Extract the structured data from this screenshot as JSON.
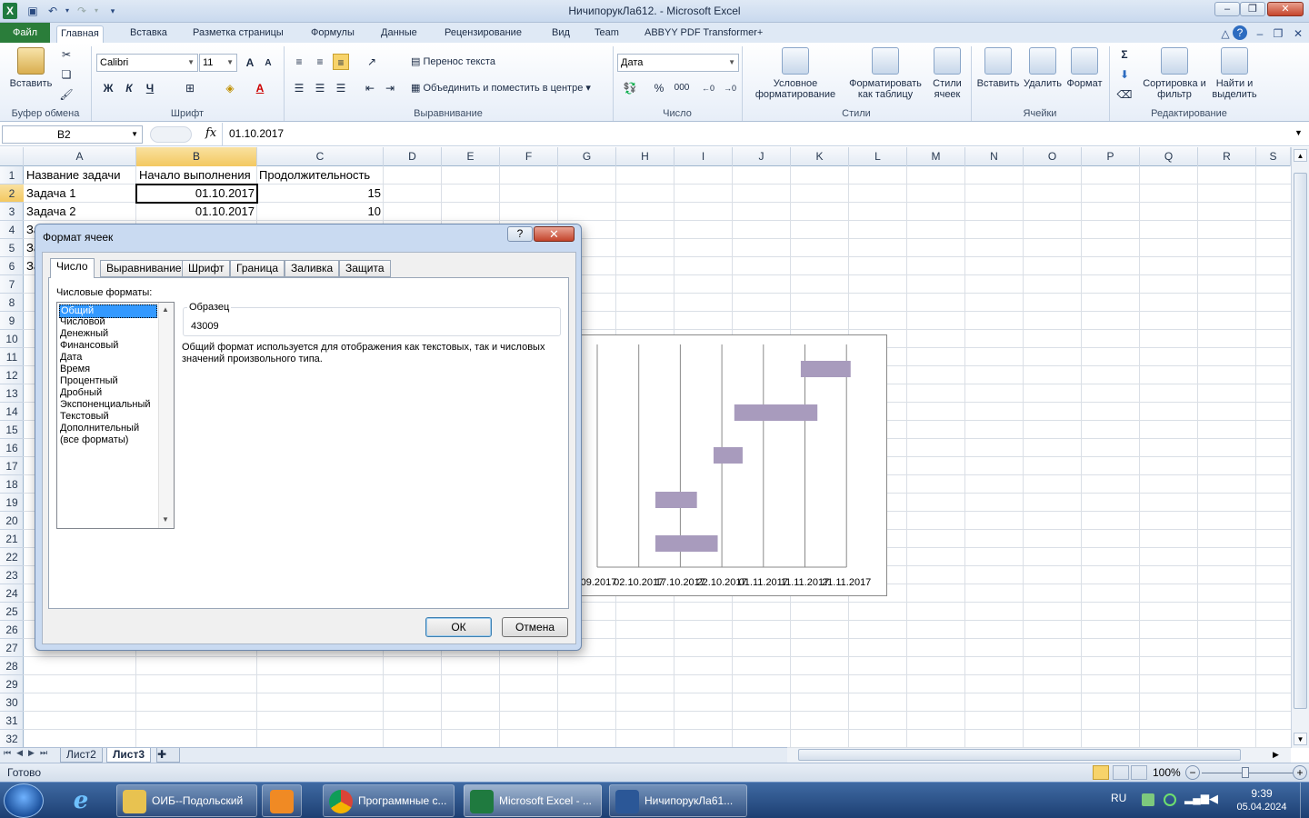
{
  "window": {
    "title": "НичипорукЛа612.  -  Microsoft Excel",
    "app_logo": "X"
  },
  "ribbon": {
    "tabs": [
      "Файл",
      "Главная",
      "Вставка",
      "Разметка страницы",
      "Формулы",
      "Данные",
      "Рецензирование",
      "Вид",
      "Team",
      "ABBYY PDF Transformer+"
    ],
    "clipboard": {
      "paste": "Вставить",
      "label": "Буфер обмена"
    },
    "font": {
      "name": "Calibri",
      "size": "11",
      "bold": "Ж",
      "italic": "К",
      "underline": "Ч",
      "label": "Шрифт"
    },
    "alignment": {
      "wrap": "Перенос текста",
      "merge": "Объединить и поместить в центре",
      "label": "Выравнивание"
    },
    "number": {
      "format": "Дата",
      "label": "Число",
      "percent": "%",
      "thousands": "000"
    },
    "styles": {
      "conditional": "Условное форматирование",
      "as_table": "Форматировать как таблицу",
      "cell_styles": "Стили ячеек",
      "label": "Стили"
    },
    "cells": {
      "insert": "Вставить",
      "delete": "Удалить",
      "format": "Формат",
      "label": "Ячейки"
    },
    "editing": {
      "sort": "Сортировка и фильтр",
      "find": "Найти и выделить",
      "label": "Редактирование",
      "sigma": "Σ"
    }
  },
  "formula_bar": {
    "name_box": "B2",
    "fx": "fx",
    "value": "01.10.2017"
  },
  "columns": [
    "A",
    "B",
    "C",
    "D",
    "E",
    "F",
    "G",
    "H",
    "I",
    "J",
    "K",
    "L",
    "M",
    "N",
    "O",
    "P",
    "Q",
    "R",
    "S"
  ],
  "rows": [
    "1",
    "2",
    "3",
    "4",
    "5",
    "6",
    "7",
    "8",
    "9",
    "10",
    "11",
    "12",
    "13",
    "14",
    "15",
    "16",
    "17",
    "18",
    "19",
    "20",
    "21",
    "22",
    "23",
    "24",
    "25",
    "26",
    "27",
    "28",
    "29",
    "30",
    "31",
    "32"
  ],
  "cells": {
    "A1": "Название задачи",
    "B1": "Начало выполнения",
    "C1": "Продолжительность",
    "A2": "Задача 1",
    "B2": "01.10.2017",
    "C2": "15",
    "A3": "Задача 2",
    "B3": "01.10.2017",
    "C3": "10",
    "A4": "За",
    "A5": "За",
    "A6": "За"
  },
  "chart_data": {
    "type": "bar",
    "orientation": "horizontal-gantt",
    "x_tick_labels": [
      ".09.2017",
      "02.10.2017",
      "17.10.2017",
      "22.10.2017",
      "01.11.2017",
      "11.11.2017",
      "21.11.2017"
    ],
    "bars_visible": 5,
    "series_color": "#a89bbd"
  },
  "sheets": [
    "Лист2",
    "Лист3"
  ],
  "active_sheet": "Лист3",
  "status": {
    "ready": "Готово",
    "zoom": "100%"
  },
  "dialog": {
    "title": "Формат ячеек",
    "help": "?",
    "close": "✕",
    "tabs": [
      "Число",
      "Выравнивание",
      "Шрифт",
      "Граница",
      "Заливка",
      "Защита"
    ],
    "formats_label": "Числовые форматы:",
    "formats": [
      "Общий",
      "Числовой",
      "Денежный",
      "Финансовый",
      "Дата",
      "Время",
      "Процентный",
      "Дробный",
      "Экспоненциальный",
      "Текстовый",
      "Дополнительный",
      "(все форматы)"
    ],
    "sample_label": "Образец",
    "sample_value": "43009",
    "description": "Общий формат используется для отображения как текстовых, так и числовых значений произвольного типа.",
    "ok": "ОК",
    "cancel": "Отмена"
  },
  "taskbar": {
    "items": [
      "ОИБ--Подольский",
      "Программные с...",
      "Microsoft Excel - ...",
      "НичипорукЛа61..."
    ],
    "lang": "RU",
    "time": "9:39",
    "date": "05.04.2024"
  }
}
